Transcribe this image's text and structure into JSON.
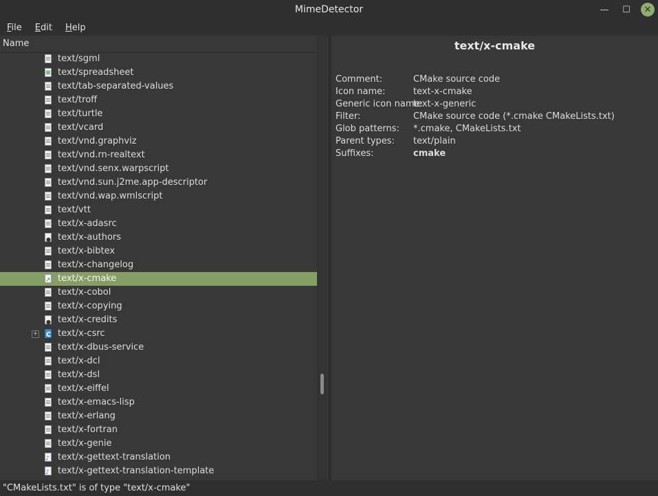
{
  "window": {
    "title": "MimeDetector"
  },
  "menu": [
    {
      "accel": "F",
      "rest": "ile"
    },
    {
      "accel": "E",
      "rest": "dit"
    },
    {
      "accel": "H",
      "rest": "elp"
    }
  ],
  "tree": {
    "column_header": "Name",
    "rows": [
      {
        "label": "text/sgml",
        "icon": "text-doc-icon"
      },
      {
        "label": "text/spreadsheet",
        "icon": "spreadsheet-icon"
      },
      {
        "label": "text/tab-separated-values",
        "icon": "text-doc-icon"
      },
      {
        "label": "text/troff",
        "icon": "text-doc-icon"
      },
      {
        "label": "text/turtle",
        "icon": "text-doc-icon"
      },
      {
        "label": "text/vcard",
        "icon": "text-doc-icon"
      },
      {
        "label": "text/vnd.graphviz",
        "icon": "text-doc-icon"
      },
      {
        "label": "text/vnd.rn-realtext",
        "icon": "text-doc-icon"
      },
      {
        "label": "text/vnd.senx.warpscript",
        "icon": "text-doc-icon"
      },
      {
        "label": "text/vnd.sun.j2me.app-descriptor",
        "icon": "text-doc-icon"
      },
      {
        "label": "text/vnd.wap.wmlscript",
        "icon": "text-doc-icon"
      },
      {
        "label": "text/vtt",
        "icon": "text-doc-icon"
      },
      {
        "label": "text/x-adasrc",
        "icon": "text-doc-icon"
      },
      {
        "label": "text/x-authors",
        "icon": "person-doc-icon"
      },
      {
        "label": "text/x-bibtex",
        "icon": "text-doc-icon"
      },
      {
        "label": "text/x-changelog",
        "icon": "text-doc-icon"
      },
      {
        "label": "text/x-cmake",
        "icon": "cmake-doc-icon",
        "selected": true
      },
      {
        "label": "text/x-cobol",
        "icon": "text-doc-icon"
      },
      {
        "label": "text/x-copying",
        "icon": "text-doc-icon"
      },
      {
        "label": "text/x-credits",
        "icon": "person-doc-icon"
      },
      {
        "label": "text/x-csrc",
        "icon": "c-source-icon",
        "expander": "+"
      },
      {
        "label": "text/x-dbus-service",
        "icon": "text-doc-icon"
      },
      {
        "label": "text/x-dcl",
        "icon": "text-doc-icon"
      },
      {
        "label": "text/x-dsl",
        "icon": "text-doc-icon"
      },
      {
        "label": "text/x-eiffel",
        "icon": "text-doc-icon"
      },
      {
        "label": "text/x-emacs-lisp",
        "icon": "text-doc-icon"
      },
      {
        "label": "text/x-erlang",
        "icon": "text-doc-icon"
      },
      {
        "label": "text/x-fortran",
        "icon": "text-doc-icon"
      },
      {
        "label": "text/x-genie",
        "icon": "text-doc-icon"
      },
      {
        "label": "text/x-gettext-translation",
        "icon": "translation-doc-icon"
      },
      {
        "label": "text/x-gettext-translation-template",
        "icon": "translation-doc-icon"
      }
    ]
  },
  "detail": {
    "title": "text/x-cmake",
    "properties": [
      {
        "key": "Comment:",
        "value": "CMake source code"
      },
      {
        "key": "Icon name:",
        "value": "text-x-cmake"
      },
      {
        "key": "Generic icon name:",
        "value": "text-x-generic"
      },
      {
        "key": "Filter:",
        "value": "CMake source code (*.cmake CMakeLists.txt)"
      },
      {
        "key": "Glob patterns:",
        "value": "*.cmake, CMakeLists.txt"
      },
      {
        "key": "Parent types:",
        "value": "text/plain"
      },
      {
        "key": "Suffixes:",
        "value": "cmake",
        "bold": true
      }
    ]
  },
  "status": {
    "text": "\"CMakeLists.txt\" is of type \"text/x-cmake\""
  },
  "colors": {
    "selection": "#859e66",
    "close_button": "#8fae6e"
  }
}
